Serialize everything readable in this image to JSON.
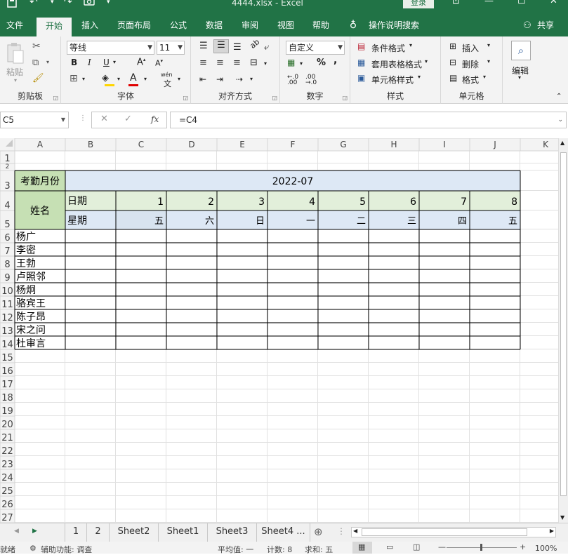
{
  "window": {
    "title": "4444.xlsx  -  Excel",
    "login": "登录"
  },
  "tabs": [
    "文件",
    "开始",
    "插入",
    "页面布局",
    "公式",
    "数据",
    "审阅",
    "视图",
    "帮助",
    "操作说明搜索",
    "共享"
  ],
  "ribbon": {
    "clipboard": {
      "paste": "粘贴",
      "label": "剪贴板"
    },
    "font": {
      "name": "等线",
      "size": "11",
      "label": "字体",
      "wen": "wén"
    },
    "align": {
      "label": "对齐方式"
    },
    "number": {
      "format": "自定义",
      "label": "数字",
      "percent": "%"
    },
    "styles": {
      "conditional": "条件格式",
      "table": "套用表格格式",
      "cell": "单元格样式",
      "label": "样式"
    },
    "cells": {
      "insert": "插入",
      "delete": "删除",
      "format": "格式",
      "label": "单元格"
    },
    "editing": {
      "label": "编辑"
    }
  },
  "formula_bar": {
    "name_box": "C5",
    "formula": "=C4",
    "fx": "fx"
  },
  "grid": {
    "columns": [
      "A",
      "B",
      "C",
      "D",
      "E",
      "F",
      "G",
      "H",
      "I",
      "J",
      "K"
    ],
    "rows": [
      "1",
      "2",
      "3",
      "4",
      "5",
      "6",
      "7",
      "8",
      "9",
      "10",
      "11",
      "12",
      "13",
      "14",
      "15",
      "16",
      "17",
      "18",
      "19",
      "20",
      "21",
      "22",
      "23",
      "24",
      "25",
      "26",
      "27"
    ],
    "month_label": "考勤月份",
    "month_value": "2022-07",
    "name_label": "姓名",
    "date_label": "日期",
    "weekday_label": "星期",
    "dates": [
      "1",
      "2",
      "3",
      "4",
      "5",
      "6",
      "7",
      "8"
    ],
    "weekdays": [
      "五",
      "六",
      "日",
      "一",
      "二",
      "三",
      "四",
      "五"
    ],
    "names": [
      "杨广",
      "李密",
      "王勃",
      "卢照邻",
      "杨炯",
      "骆宾王",
      "陈子昂",
      "宋之问",
      "杜审言"
    ]
  },
  "sheets": [
    "1",
    "2",
    "Sheet2",
    "Sheet1",
    "Sheet3",
    "Sheet4 ..."
  ],
  "status": {
    "ready": "就绪",
    "accessibility": "辅助功能: 调查",
    "average": "平均值: 一",
    "count": "计数: 8",
    "sum": "求和: 五",
    "zoom": "100%"
  },
  "colors": {
    "excel_green": "#217346",
    "header_blue": "#dde8f5",
    "header_green": "#e2efda",
    "label_green": "#c6e0b4"
  }
}
